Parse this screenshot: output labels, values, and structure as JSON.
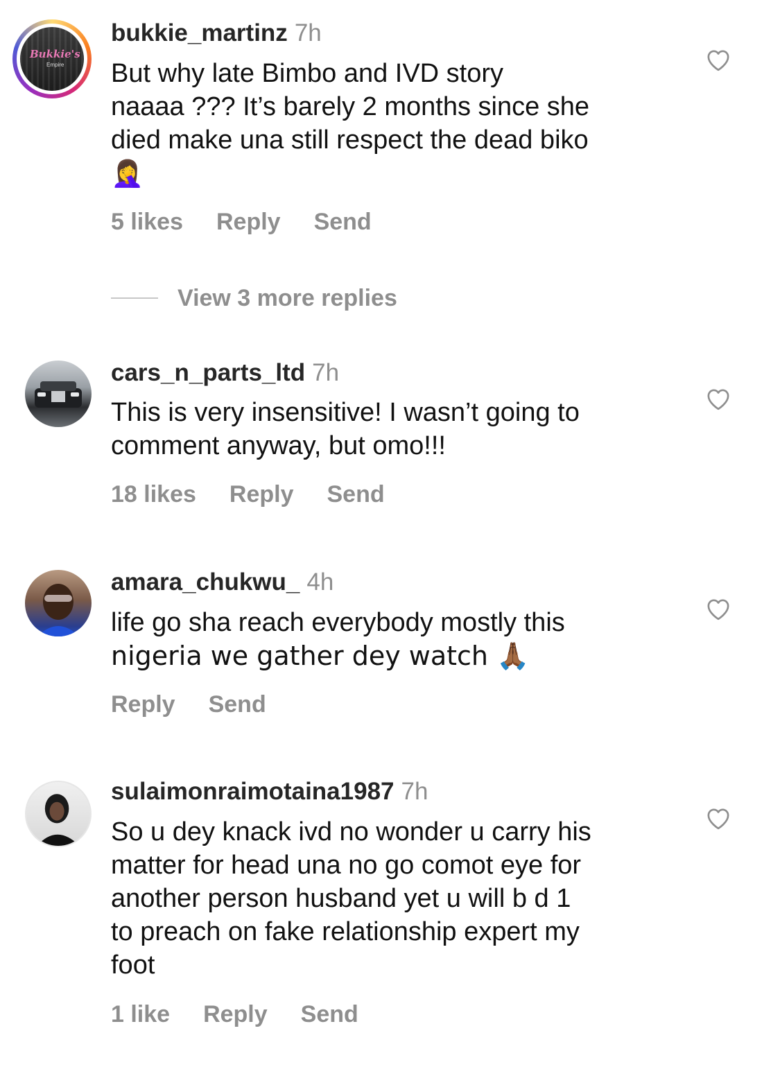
{
  "comments": [
    {
      "username": "bukkie_martinz",
      "time": "7h",
      "text_lines": [
        "But why late Bimbo and IVD story",
        "naaaa ??? It’s barely 2 months since she",
        "died make una still respect the dead biko",
        "🤦‍♀️"
      ],
      "likes": "5 likes",
      "reply": "Reply",
      "send": "Send",
      "avatar_text": "Bukkie's",
      "avatar_sub": "Empire"
    },
    {
      "username": "cars_n_parts_ltd",
      "time": "7h",
      "text_lines": [
        "This is very insensitive! I wasn’t going to",
        "comment anyway, but omo!!!"
      ],
      "likes": "18 likes",
      "reply": "Reply",
      "send": "Send"
    },
    {
      "username": "amara_chukwu_",
      "time": "4h",
      "text_lines": [
        "life go sha reach everybody mostly this",
        "nigeria we gather dey watch 🙏🏾"
      ],
      "reply": "Reply",
      "send": "Send"
    },
    {
      "username": "sulaimonraimotaina1987",
      "time": "7h",
      "text_lines": [
        "So u dey knack ivd no wonder u carry his",
        "matter for head una no go comot eye for",
        "another person husband yet u will b d 1",
        "to preach on fake relationship expert my",
        "foot"
      ],
      "likes": "1 like",
      "reply": "Reply",
      "send": "Send"
    }
  ],
  "view_replies": "View 3 more replies",
  "icons": {
    "like": "heart-outline-icon"
  },
  "colors": {
    "muted": "#8e8e8e",
    "username": "#262626"
  }
}
